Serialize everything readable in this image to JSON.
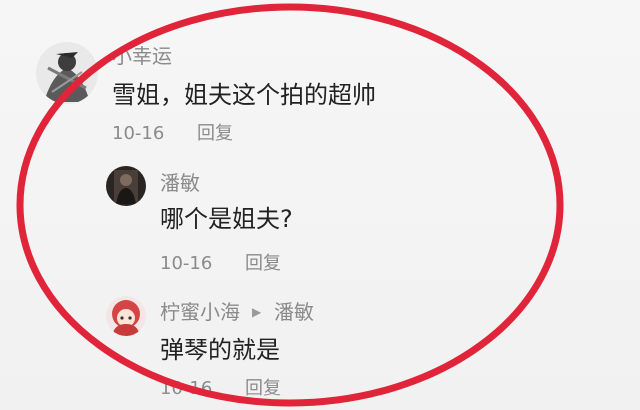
{
  "comments": {
    "c1": {
      "username": "小幸运",
      "text": "雪姐，姐夫这个拍的超帅",
      "date": "10-16",
      "reply_label": "回复",
      "avatar_icon": "ink-warrior-avatar"
    },
    "c2": {
      "username": "潘敏",
      "text": "哪个是姐夫?",
      "date": "10-16",
      "reply_label": "回复",
      "avatar_icon": "dark-figure-avatar"
    },
    "c3": {
      "username": "柠蜜小海",
      "reply_to": "潘敏",
      "text": "弹琴的就是",
      "date": "10-16",
      "reply_label": "回复",
      "avatar_icon": "red-hair-anime-avatar"
    }
  },
  "annotation": {
    "shape": "ellipse",
    "color": "#e0243a"
  }
}
